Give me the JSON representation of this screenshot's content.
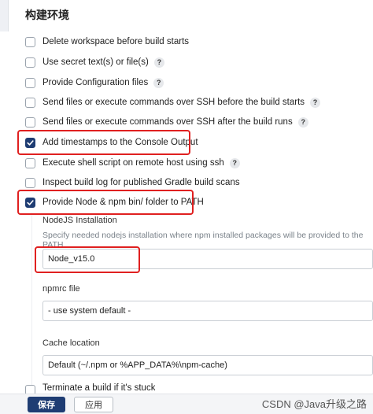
{
  "section": {
    "title": "构建环境"
  },
  "options": [
    {
      "label": "Delete workspace before build starts",
      "checked": false,
      "help": false
    },
    {
      "label": "Use secret text(s) or file(s)",
      "checked": false,
      "help": true
    },
    {
      "label": "Provide Configuration files",
      "checked": false,
      "help": true
    },
    {
      "label": "Send files or execute commands over SSH before the build starts",
      "checked": false,
      "help": true
    },
    {
      "label": "Send files or execute commands over SSH after the build runs",
      "checked": false,
      "help": true
    },
    {
      "label": "Add timestamps to the Console Output",
      "checked": true,
      "help": false
    },
    {
      "label": "Execute shell script on remote host using ssh",
      "checked": false,
      "help": true
    },
    {
      "label": "Inspect build log for published Gradle build scans",
      "checked": false,
      "help": false
    },
    {
      "label": "Provide Node & npm bin/ folder to PATH",
      "checked": true,
      "help": false
    }
  ],
  "help_glyph": "?",
  "nodejs": {
    "label": "NodeJS Installation",
    "description": "Specify needed nodejs installation where npm installed packages will be provided to the PATH",
    "value": "Node_v15.0"
  },
  "npmrc": {
    "label": "npmrc file",
    "value": "- use system default -"
  },
  "cache": {
    "label": "Cache location",
    "value": "Default (~/.npm or %APP_DATA%\\npm-cache)"
  },
  "partial_option": {
    "label": "Terminate a build if it's stuck",
    "checked": false
  },
  "buttons": {
    "save": "保存",
    "apply": "应用"
  },
  "watermark": "CSDN @Java升级之路",
  "colors": {
    "accent": "#1f3d73",
    "highlight": "#e02020"
  },
  "icons": {
    "check": "check-icon",
    "help": "help-icon"
  }
}
